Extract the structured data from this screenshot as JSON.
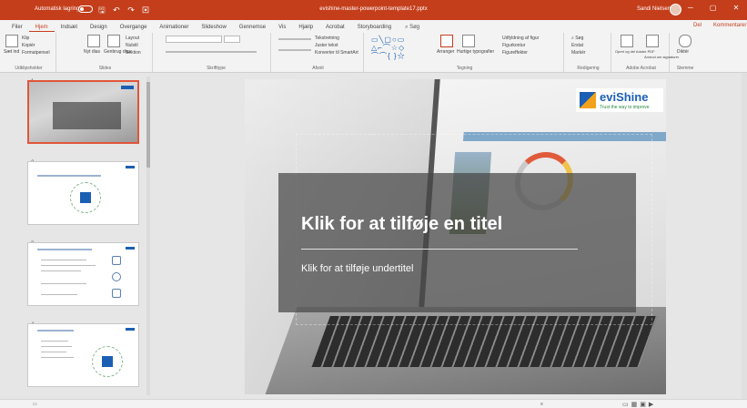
{
  "titlebar": {
    "autosave_label": "Automatisk lagring",
    "qat_icons": [
      "save-icon",
      "undo-icon",
      "redo-icon",
      "present-icon"
    ],
    "qat_glyphs": "🖫 ↶ ↷ ▣",
    "file_name": "evishine-master-powerpoint-template17.pptx",
    "user_name": "Sandi Nielsen",
    "window_glyphs": "─ ▢ ✕"
  },
  "ribbon": {
    "tabs": [
      "Filer",
      "Hjem",
      "Indsæt",
      "Design",
      "Overgange",
      "Animationer",
      "Slideshow",
      "Gennemse",
      "Vis",
      "Hjælp",
      "Acrobat",
      "Storyboarding"
    ],
    "active_tab": "Hjem",
    "search_label": "Søg",
    "share_label": "Del",
    "comments_label": "Kommentarer",
    "groups": {
      "clipboard": {
        "label": "Udklipsholder",
        "paste": "Sæt ind",
        "cut": "Klip",
        "copy": "Kopiér",
        "format_painter": "Formatpensel"
      },
      "slides": {
        "label": "Slides",
        "new_slide": "Nyt dias",
        "reuse": "Genbrug dias",
        "layout": "Layout",
        "reset": "Nulstil",
        "section": "Sektion"
      },
      "font": {
        "label": "Skrifttype"
      },
      "paragraph": {
        "label": "Afsnit",
        "text_direction": "Tekstretning",
        "align_text": "Juster tekst",
        "smartart": "Konverter til SmartArt"
      },
      "drawing": {
        "label": "Tegning",
        "arrange": "Arranger",
        "quick_styles": "Hurtige typografier",
        "shape_fill": "Udfyldning af figur",
        "shape_outline": "Figurkontur",
        "shape_effects": "Figureffekter"
      },
      "editing": {
        "label": "Redigering",
        "find": "Søg",
        "replace": "Erstat",
        "select": "Markér"
      },
      "acrobat": {
        "label": "Adobe Acrobat",
        "create_pdf": "Opret og del Adobe PDF",
        "request_signatures": "Anmod om signaturer"
      },
      "voice": {
        "label": "Stemme",
        "dictate": "Diktér"
      }
    }
  },
  "thumbnails": [
    {
      "number": "1",
      "selected": true
    },
    {
      "number": "2",
      "selected": false
    },
    {
      "number": "3",
      "selected": false
    },
    {
      "number": "4",
      "selected": false
    }
  ],
  "slide": {
    "brand_name": "eviShine",
    "brand_tagline": "Trust the way to improve",
    "title_placeholder": "Klik for at tilføje en titel",
    "subtitle_placeholder": "Klik for at tilføje undertitel"
  },
  "colors": {
    "accent": "#c43e1c",
    "brand_blue": "#1b5fb4"
  }
}
